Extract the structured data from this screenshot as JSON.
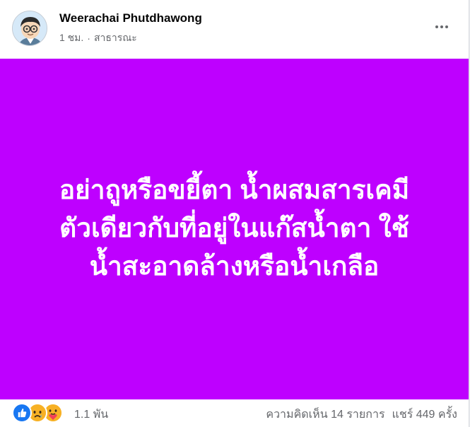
{
  "post": {
    "author": "Weerachai Phutdhawong",
    "time": "1 ชม.",
    "separator": "·",
    "audience": "สาธารณะ",
    "image_text_lines": [
      "อย่าถูหรือขยี้ตา น้ำผสมสารเคมี",
      "ตัวเดียวกับที่อยู่ในแก๊สน้ำตา ใช้",
      "น้ำสะอาดล้างหรือน้ำเกลือ"
    ],
    "image_background": "#be00ff"
  },
  "footer": {
    "reactions": [
      "like-icon",
      "sad-icon",
      "care-icon"
    ],
    "reaction_count": "1.1 พัน",
    "comments": "ความคิดเห็น 14 รายการ",
    "shares": "แชร์ 449 ครั้ง"
  }
}
